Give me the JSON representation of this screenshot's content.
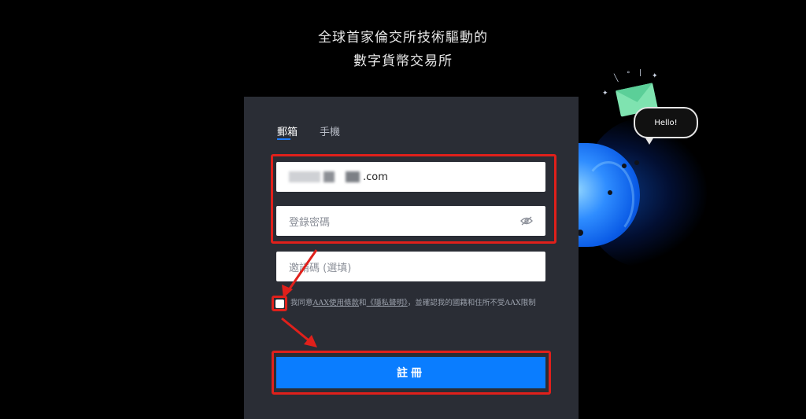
{
  "headline": {
    "line1": "全球首家倫交所技術驅動的",
    "line2": "數字貨幣交易所"
  },
  "tabs": [
    {
      "label": "郵箱",
      "active": true
    },
    {
      "label": "手機",
      "active": false
    }
  ],
  "form": {
    "email_value": ".com",
    "password_placeholder": "登錄密碼",
    "invite_placeholder": "邀請碼 (選填)"
  },
  "agreement": {
    "prefix": "我同意",
    "terms_link": "AAX使用條款",
    "and": "和",
    "privacy_link": "《隱私聲明》",
    "suffix": "，並確認我的國籍和住所不受AAX限制"
  },
  "submit_label": "註冊",
  "decoration": {
    "bubble_text": "Hello!"
  },
  "colors": {
    "accent": "#0a7dff",
    "card_bg": "#2a2d35",
    "annotation": "#e0201b"
  }
}
